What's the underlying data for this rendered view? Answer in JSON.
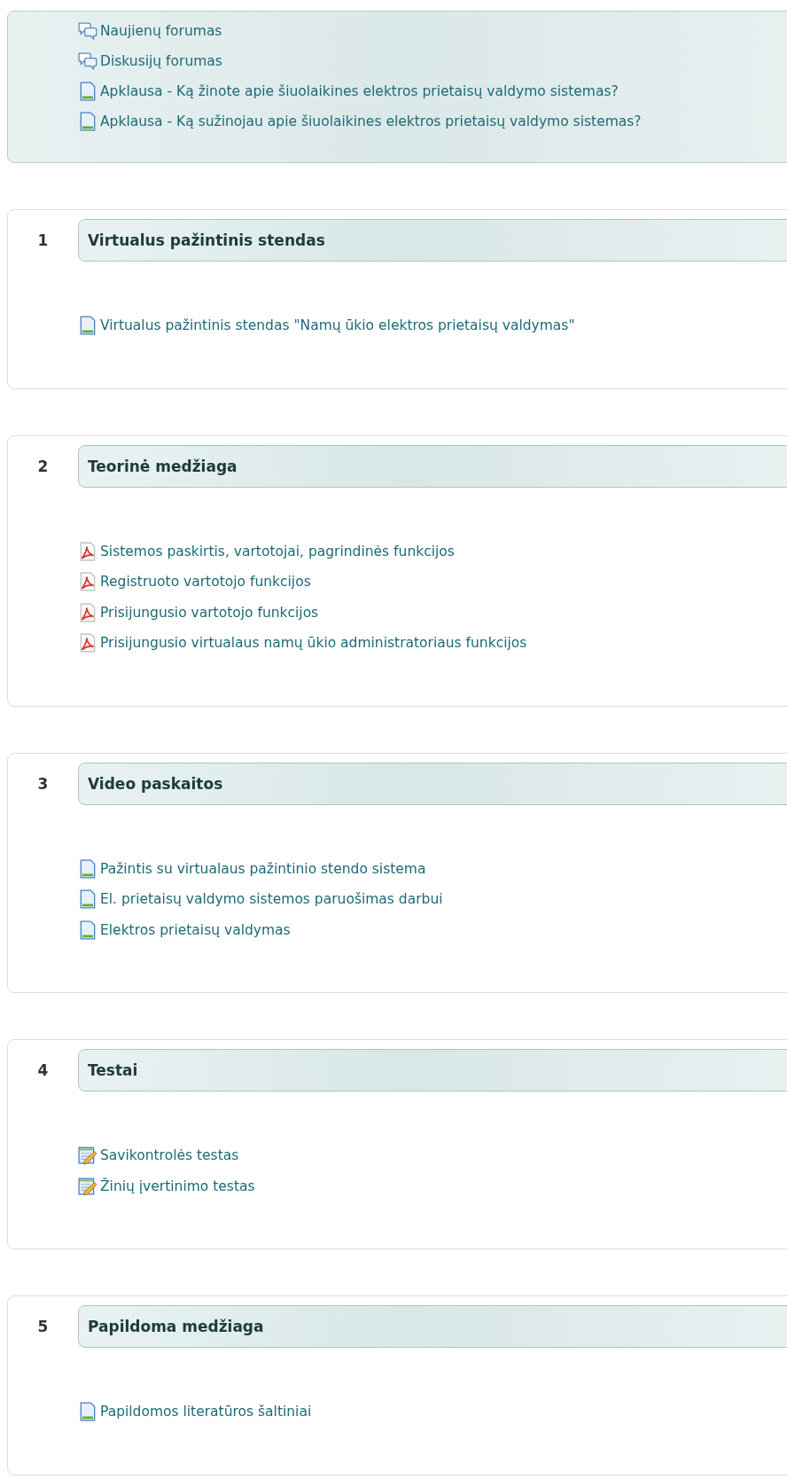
{
  "top_box": {
    "items": [
      {
        "label": "Naujienų forumas",
        "kind": "forum"
      },
      {
        "label": "Diskusijų forumas",
        "kind": "forum"
      },
      {
        "label": "Apklausa - Ką žinote apie šiuolaikines elektros prietaisų valdymo sistemas?",
        "kind": "page"
      },
      {
        "label": "Apklausa - Ką sužinojau apie šiuolaikines elektros prietaisų valdymo sistemas?",
        "kind": "page"
      }
    ]
  },
  "sections": [
    {
      "number": "1",
      "title": "Virtualus pažintinis stendas",
      "items": [
        {
          "label": "Virtualus pažintinis stendas \"Namų ūkio elektros prietaisų valdymas\"",
          "kind": "page"
        }
      ]
    },
    {
      "number": "2",
      "title": "Teorinė medžiaga",
      "items": [
        {
          "label": "Sistemos paskirtis, vartotojai, pagrindinės funkcijos",
          "kind": "pdf"
        },
        {
          "label": "Registruoto vartotojo funkcijos",
          "kind": "pdf"
        },
        {
          "label": "Prisijungusio vartotojo funkcijos",
          "kind": "pdf"
        },
        {
          "label": "Prisijungusio virtualaus namų ūkio administratoriaus funkcijos",
          "kind": "pdf"
        }
      ]
    },
    {
      "number": "3",
      "title": "Video paskaitos",
      "items": [
        {
          "label": "Pažintis su virtualaus pažintinio stendo sistema",
          "kind": "page"
        },
        {
          "label": "El. prietaisų valdymo sistemos paruošimas darbui",
          "kind": "page"
        },
        {
          "label": "Elektros prietaisų valdymas",
          "kind": "page"
        }
      ]
    },
    {
      "number": "4",
      "title": "Testai",
      "items": [
        {
          "label": "Savikontrolės testas",
          "kind": "quiz"
        },
        {
          "label": "Žinių įvertinimo testas",
          "kind": "quiz"
        }
      ]
    },
    {
      "number": "5",
      "title": "Papildoma medžiaga",
      "items": [
        {
          "label": "Papildomos literatūros šaltiniai",
          "kind": "page"
        }
      ]
    }
  ]
}
